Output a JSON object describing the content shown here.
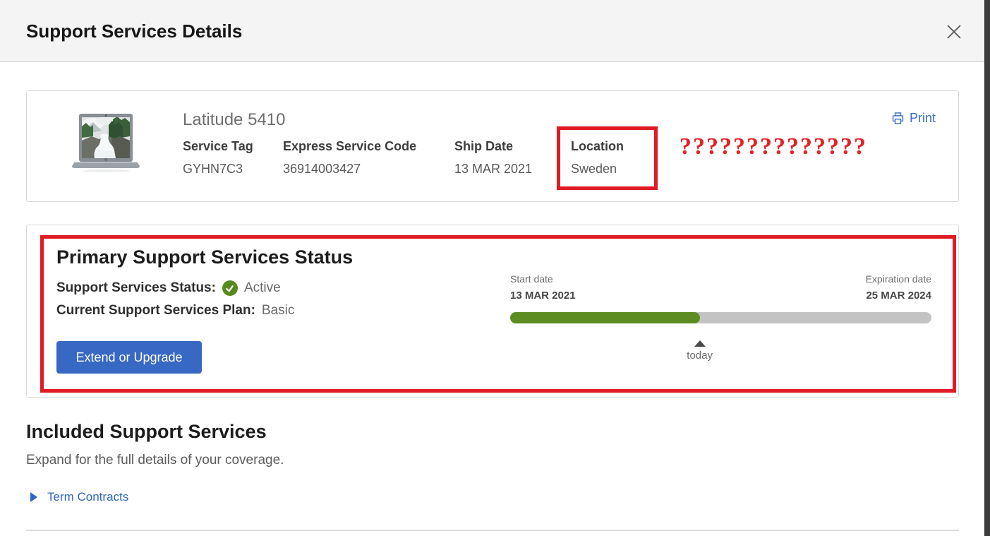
{
  "dialog": {
    "title": "Support Services Details"
  },
  "product": {
    "name": "Latitude 5410",
    "fields": [
      {
        "label": "Service Tag",
        "value": "GYHN7C3"
      },
      {
        "label": "Express Service Code",
        "value": "36914003427"
      },
      {
        "label": "Ship Date",
        "value": "13 MAR 2021"
      },
      {
        "label": "Location",
        "value": "Sweden",
        "highlighted": true
      }
    ],
    "annotation_question_marks": "??????????????",
    "print_label": "Print"
  },
  "primary_status": {
    "heading": "Primary Support Services Status",
    "status_label": "Support Services Status:",
    "status_value": "Active",
    "plan_label": "Current Support Services Plan:",
    "plan_value": "Basic",
    "button_label": "Extend or Upgrade",
    "timeline": {
      "start_label": "Start date",
      "start_date": "13 MAR 2021",
      "expiration_label": "Expiration date",
      "expiration_date": "25 MAR 2024",
      "today_label": "today",
      "progress_percent": 45
    }
  },
  "included": {
    "heading": "Included Support Services",
    "subtitle": "Expand for the full details of your coverage.",
    "term_contracts_label": "Term Contracts"
  },
  "colors": {
    "accent_blue": "#3768c4",
    "link_blue": "#3a6ec6",
    "status_green": "#568a1f",
    "progress_green": "#5d8d22",
    "progress_track": "#c3c3c3",
    "annotation_red": "#e01b24"
  },
  "icons": {
    "close": "close-icon",
    "print": "printer-icon",
    "status": "check-circle-icon",
    "today_marker": "triangle-up-icon",
    "expand": "triangle-right-icon"
  }
}
